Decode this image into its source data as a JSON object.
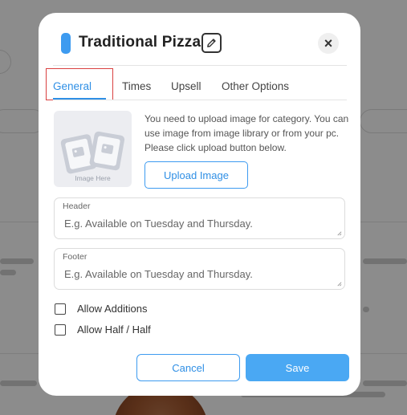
{
  "colors": {
    "accent": "#3d9bf0",
    "accent_text": "#2f8fe5",
    "highlight_border": "#d94040",
    "save_bg": "#4aa8f3"
  },
  "modal": {
    "title": "Traditional Pizza",
    "edit_icon": "edit-icon",
    "close_icon": "close-icon",
    "close_glyph": "×"
  },
  "tabs": [
    {
      "label": "General",
      "active": true
    },
    {
      "label": "Times",
      "active": false
    },
    {
      "label": "Upsell",
      "active": false
    },
    {
      "label": "Other Options",
      "active": false
    }
  ],
  "image_upload": {
    "placeholder_caption": "Image Here",
    "description": "You need to upload image for category. You can use image from image library or from your pc. Please click upload button below.",
    "upload_label": "Upload Image"
  },
  "header_field": {
    "label": "Header",
    "placeholder": "E.g. Available on Tuesday and Thursday."
  },
  "footer_field": {
    "label": "Footer",
    "placeholder": "E.g. Available on Tuesday and Thursday."
  },
  "options": [
    {
      "label": "Allow Additions",
      "checked": false
    },
    {
      "label": "Allow Half / Half",
      "checked": false
    }
  ],
  "actions": {
    "cancel_label": "Cancel",
    "save_label": "Save"
  }
}
